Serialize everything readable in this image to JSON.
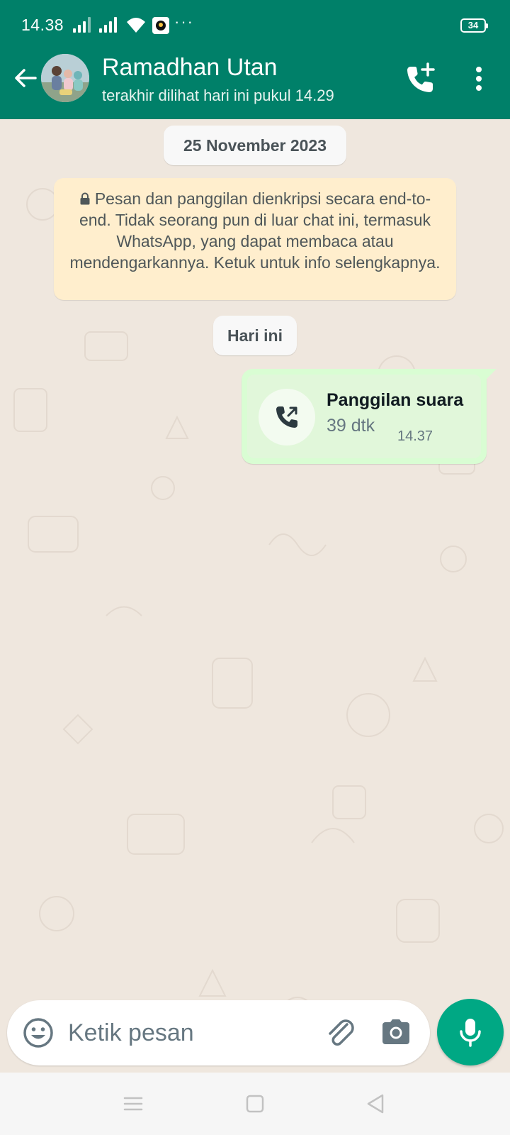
{
  "status_bar": {
    "time": "14.38",
    "battery": "34",
    "more": "···",
    "icons": [
      "signal-icon",
      "signal-icon",
      "wifi-icon",
      "app-notification-icon"
    ]
  },
  "chat_header": {
    "contact_name": "Ramadhan Utan",
    "last_seen": "terakhir dilihat hari ini pukul 14.29",
    "icons": [
      "back-arrow-icon",
      "avatar",
      "add-call-icon",
      "more-vertical-icon"
    ]
  },
  "messages": {
    "date_chip": "25 November 2023",
    "encryption_notice": "Pesan dan panggilan dienkripsi secara end-to-end. Tidak seorang pun di luar chat ini, termasuk WhatsApp, yang dapat membaca atau mendengarkannya. Ketuk untuk info selengkapnya.",
    "today_chip": "Hari ini",
    "call": {
      "title": "Panggilan suara",
      "duration": "39 dtk",
      "time": "14.37",
      "icon": "outgoing-call-icon"
    }
  },
  "composer": {
    "placeholder": "Ketik pesan",
    "icons": [
      "emoji-icon",
      "attachment-icon",
      "camera-icon",
      "microphone-icon"
    ]
  },
  "navigation_bar": {
    "icons": [
      "menu-icon",
      "home-icon",
      "back-icon"
    ]
  },
  "colors": {
    "header": "#008069",
    "chat_background": "#efe7de",
    "outgoing_bubble": "#d9fdd3",
    "encryption_note": "#ffeecd",
    "accent": "#00a884"
  }
}
